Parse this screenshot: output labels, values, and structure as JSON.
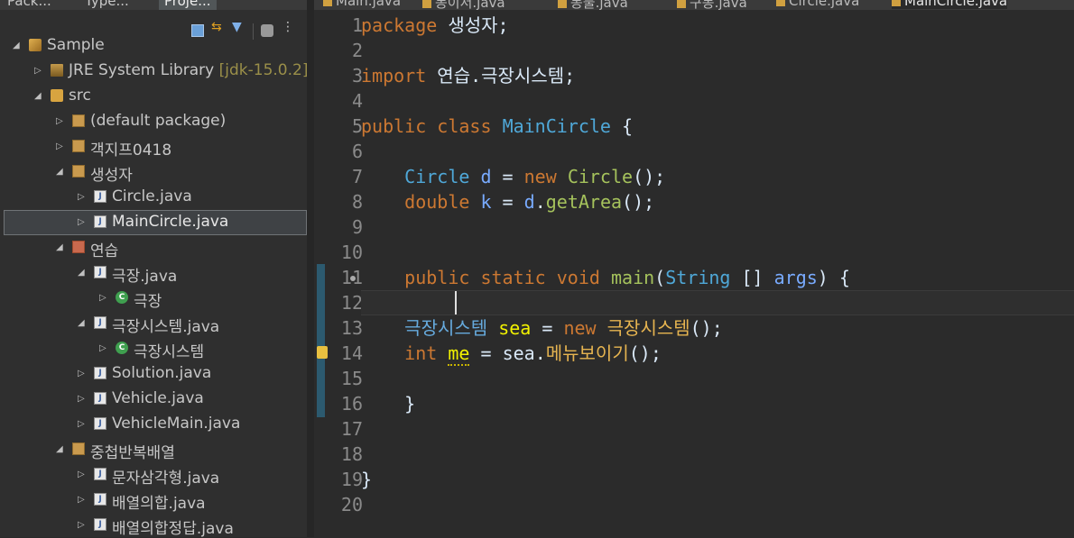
{
  "left_panel": {
    "tabs": [
      {
        "label": "Pack...",
        "active": false
      },
      {
        "label": "Type...",
        "active": false
      },
      {
        "label": "Proje...",
        "active": true
      }
    ],
    "tree": [
      {
        "label": "Sample",
        "decoration": "",
        "icon": "project-icon",
        "expanded": true
      },
      {
        "label": "JRE System Library",
        "decoration": "[jdk-15.0.2]",
        "icon": "library-icon",
        "expanded": false
      },
      {
        "label": "src",
        "decoration": "",
        "icon": "source-folder-icon",
        "expanded": true
      },
      {
        "label": "(default package)",
        "decoration": "",
        "icon": "package-icon",
        "expanded": false
      },
      {
        "label": "객지프0418",
        "decoration": "",
        "icon": "package-icon",
        "expanded": false
      },
      {
        "label": "생성자",
        "decoration": "",
        "icon": "package-icon",
        "expanded": true
      },
      {
        "label": "Circle.java",
        "decoration": "",
        "icon": "java-file-icon",
        "expanded": false
      },
      {
        "label": "MainCircle.java",
        "decoration": "",
        "icon": "java-file-icon",
        "expanded": false,
        "selected": true
      },
      {
        "label": "연습",
        "decoration": "",
        "icon": "package-icon",
        "expanded": true
      },
      {
        "label": "극장.java",
        "decoration": "",
        "icon": "java-file-icon",
        "expanded": true
      },
      {
        "label": "극장",
        "decoration": "",
        "icon": "class-icon",
        "expanded": false
      },
      {
        "label": "극장시스템.java",
        "decoration": "",
        "icon": "java-file-icon",
        "expanded": true
      },
      {
        "label": "극장시스템",
        "decoration": "",
        "icon": "class-icon",
        "expanded": false
      },
      {
        "label": "Solution.java",
        "decoration": "",
        "icon": "java-file-icon",
        "expanded": false
      },
      {
        "label": "Vehicle.java",
        "decoration": "",
        "icon": "java-file-icon",
        "expanded": false
      },
      {
        "label": "VehicleMain.java",
        "decoration": "",
        "icon": "java-file-icon",
        "expanded": false
      },
      {
        "label": "중첩반복배열",
        "decoration": "",
        "icon": "package-icon",
        "expanded": true
      },
      {
        "label": "문자삼각형.java",
        "decoration": "",
        "icon": "java-file-icon",
        "expanded": false
      },
      {
        "label": "배열의합.java",
        "decoration": "",
        "icon": "java-file-icon",
        "expanded": false
      },
      {
        "label": "배열의합정답.java",
        "decoration": "",
        "icon": "java-file-icon",
        "expanded": false
      }
    ]
  },
  "editor": {
    "tabs": [
      {
        "label": "Main.java",
        "active": false
      },
      {
        "label": "동이서.java",
        "active": false
      },
      {
        "label": "동물.java",
        "active": false
      },
      {
        "label": "구동.java",
        "active": false
      },
      {
        "label": "Circle.java",
        "active": false
      },
      {
        "label": "MainCircle.java",
        "active": true
      }
    ],
    "line_numbers": [
      "1",
      "2",
      "3",
      "4",
      "5",
      "6",
      "7",
      "8",
      "9",
      "10",
      "11",
      "12",
      "13",
      "14",
      "15",
      "16",
      "17",
      "18",
      "19",
      "20"
    ],
    "code": {
      "l1_kw": "package",
      "l1_rest": " 생성자;",
      "l3_kw": "import",
      "l3_rest": " 연습.극장시스템;",
      "l5_kw1": "public",
      "l5_kw2": "class",
      "l5_name": "MainCircle",
      "l5_rest": " {",
      "l7_type": "Circle",
      "l7_var": "d",
      "l7_eq": " = ",
      "l7_new": "new",
      "l7_ctor": "Circle",
      "l7_rest": "();",
      "l8_type": "double",
      "l8_var": "k",
      "l8_eq": " = ",
      "l8_obj": "d",
      "l8_dot": ".",
      "l8_call": "getArea",
      "l8_rest": "();",
      "l11_kw1": "public",
      "l11_kw2": "static",
      "l11_kw3": "void",
      "l11_name": "main",
      "l11_p1": "(",
      "l11_type": "String",
      "l11_mid": " [] ",
      "l11_arg": "args",
      "l11_rest": ") {",
      "l13_type": "극장시스템",
      "l13_var": "sea",
      "l13_eq": " = ",
      "l13_new": "new",
      "l13_ctor": "극장시스템",
      "l13_rest": "();",
      "l14_type": "int",
      "l14_var": "me",
      "l14_eq": " = ",
      "l14_obj": "sea",
      "l14_dot": ".",
      "l14_call": "메뉴보이기",
      "l14_rest": "();",
      "l16": "}",
      "l19": "}"
    }
  }
}
